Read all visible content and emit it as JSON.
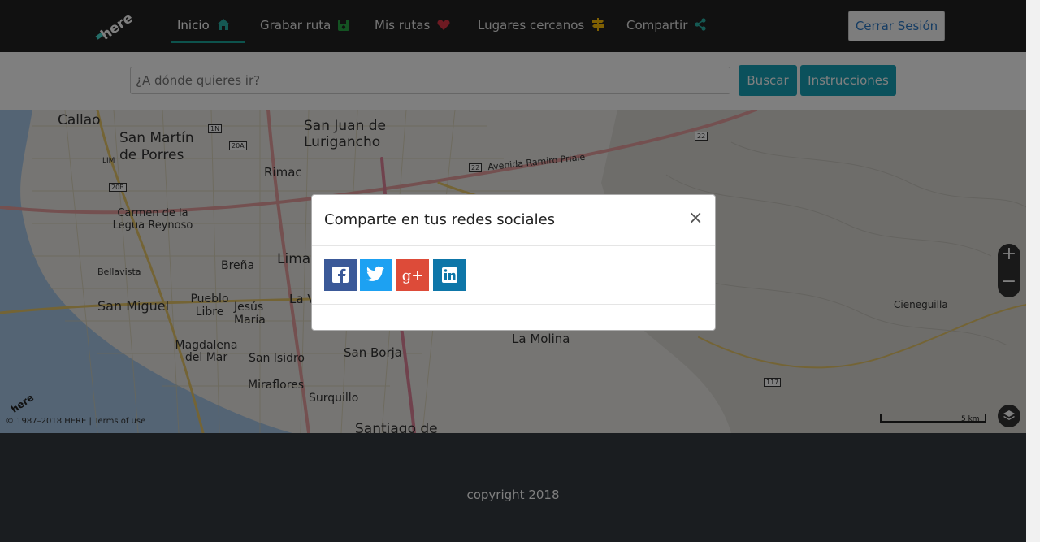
{
  "nav": {
    "logo_text": "here",
    "items": [
      {
        "label": "Inicio",
        "icon": "home-icon"
      },
      {
        "label": "Grabar ruta",
        "icon": "save-icon"
      },
      {
        "label": "Mis rutas",
        "icon": "heart-icon"
      },
      {
        "label": "Lugares cercanos",
        "icon": "signpost-icon"
      },
      {
        "label": "Compartir",
        "icon": "share-icon"
      }
    ],
    "logout_label": "Cerrar Sesión"
  },
  "search": {
    "placeholder": "¿A dónde quieres ir?",
    "search_label": "Buscar",
    "instructions_label": "Instrucciones"
  },
  "map": {
    "labels": [
      "Callao",
      "San Martín de Porres",
      "San Juan de Lurigancho",
      "Rimac",
      "Carmen de la Legua Reynoso",
      "Bellavista",
      "Breña",
      "Lima",
      "San Miguel",
      "Pueblo Libre",
      "Jesús María",
      "La V",
      "Magdalena del Mar",
      "San Isidro",
      "San Borja",
      "Miraflores",
      "Surquillo",
      "Santiago de",
      "La Molina",
      "Cieneguilla",
      "Avenida Ramiro Priale",
      "LIM"
    ],
    "road_shields": [
      "1N",
      "20A",
      "20B",
      "22",
      "22",
      "117"
    ],
    "copyright": "© 1987–2018 HERE | Terms of use",
    "scale_label": "5 km",
    "zoom_in": "+",
    "zoom_out": "−"
  },
  "modal": {
    "title": "Comparte en tus redes sociales",
    "close": "×",
    "social": [
      {
        "name": "facebook",
        "color": "#3b5998",
        "glyph": "f"
      },
      {
        "name": "twitter",
        "color": "#1da1f2",
        "glyph": "t"
      },
      {
        "name": "google-plus",
        "color": "#dd4b39",
        "glyph": "g+"
      },
      {
        "name": "linkedin",
        "color": "#0e76a8",
        "glyph": "in"
      }
    ]
  },
  "footer": {
    "copyright": "copyright 2018"
  }
}
